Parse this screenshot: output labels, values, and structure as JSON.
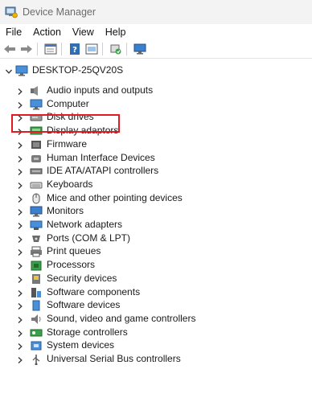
{
  "window": {
    "title": "Device Manager"
  },
  "menu": [
    {
      "label": "File"
    },
    {
      "label": "Action"
    },
    {
      "label": "View"
    },
    {
      "label": "Help"
    }
  ],
  "toolbar": {
    "buttons": [
      {
        "icon": "back-arrow-icon"
      },
      {
        "icon": "forward-arrow-icon"
      },
      {
        "icon": "properties-icon"
      },
      {
        "icon": "help-icon"
      },
      {
        "icon": "update-driver-icon"
      },
      {
        "icon": "scan-hardware-icon"
      },
      {
        "icon": "monitor-icon"
      }
    ]
  },
  "tree": {
    "root": {
      "label": "DESKTOP-25QV20S",
      "icon": "computer-icon",
      "expanded": true
    },
    "items": [
      {
        "label": "Audio inputs and outputs",
        "icon": "speaker-icon"
      },
      {
        "label": "Computer",
        "icon": "computer-icon"
      },
      {
        "label": "Disk drives",
        "icon": "disk-drive-icon"
      },
      {
        "label": "Display adaptors",
        "icon": "display-adapter-icon",
        "highlighted": true
      },
      {
        "label": "Firmware",
        "icon": "firmware-icon"
      },
      {
        "label": "Human Interface Devices",
        "icon": "hid-icon"
      },
      {
        "label": "IDE ATA/ATAPI controllers",
        "icon": "ide-controller-icon"
      },
      {
        "label": "Keyboards",
        "icon": "keyboard-icon"
      },
      {
        "label": "Mice and other pointing devices",
        "icon": "mouse-icon"
      },
      {
        "label": "Monitors",
        "icon": "monitor-icon"
      },
      {
        "label": "Network adapters",
        "icon": "network-adapter-icon"
      },
      {
        "label": "Ports (COM & LPT)",
        "icon": "port-icon"
      },
      {
        "label": "Print queues",
        "icon": "printer-icon"
      },
      {
        "label": "Processors",
        "icon": "processor-icon"
      },
      {
        "label": "Security devices",
        "icon": "security-icon"
      },
      {
        "label": "Software components",
        "icon": "software-component-icon"
      },
      {
        "label": "Software devices",
        "icon": "software-device-icon"
      },
      {
        "label": "Sound, video and game controllers",
        "icon": "sound-icon"
      },
      {
        "label": "Storage controllers",
        "icon": "storage-controller-icon"
      },
      {
        "label": "System devices",
        "icon": "system-device-icon"
      },
      {
        "label": "Universal Serial Bus controllers",
        "icon": "usb-icon"
      }
    ]
  },
  "colors": {
    "highlight": "#e01b24",
    "accent": "#1e7fd6"
  }
}
